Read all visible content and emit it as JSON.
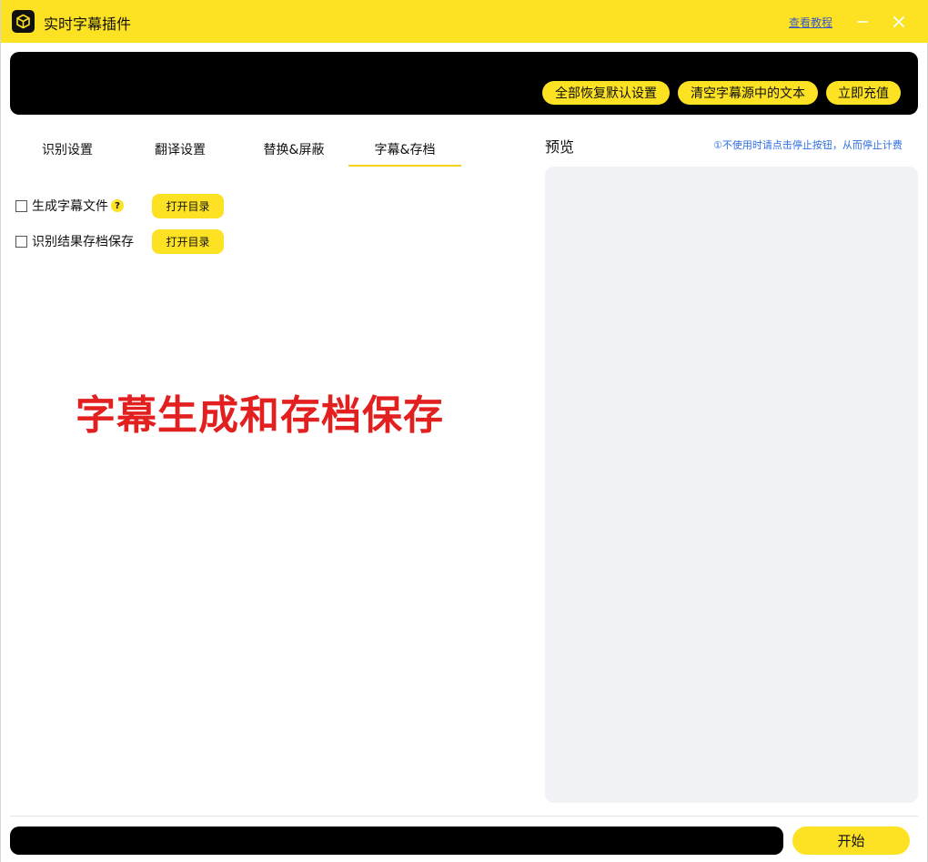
{
  "titlebar": {
    "app_icon": "cube-icon",
    "title": "实时字幕插件",
    "tutorial_link": "查看教程",
    "minimize_icon": "minimize-icon",
    "close_icon": "close-icon",
    "bg_color": "#fde223"
  },
  "topbar": {
    "buttons": {
      "reset": "全部恢复默认设置",
      "clear": "清空字幕源中的文本",
      "recharge": "立即充值"
    }
  },
  "tabs": [
    {
      "label": "识别设置",
      "active": false
    },
    {
      "label": "翻译设置",
      "active": false
    },
    {
      "label": "替换&屏蔽",
      "active": false
    },
    {
      "label": "字幕&存档",
      "active": true
    }
  ],
  "options": {
    "generate_subtitle": {
      "label": "生成字幕文件",
      "checked": false,
      "help_icon": "?",
      "button": "打开目录"
    },
    "archive_results": {
      "label": "识别结果存档保存",
      "checked": false,
      "button": "打开目录"
    }
  },
  "overlay_caption": "字幕生成和存档保存",
  "preview": {
    "title": "预览",
    "hint": "①不使用时请点击停止按钮，从而停止计费"
  },
  "bottom": {
    "start_button": "开始"
  },
  "colors": {
    "accent": "#fde223",
    "caption_red": "#e32020",
    "hint_blue": "#2f6fe0",
    "preview_bg": "#f1f2f5"
  }
}
